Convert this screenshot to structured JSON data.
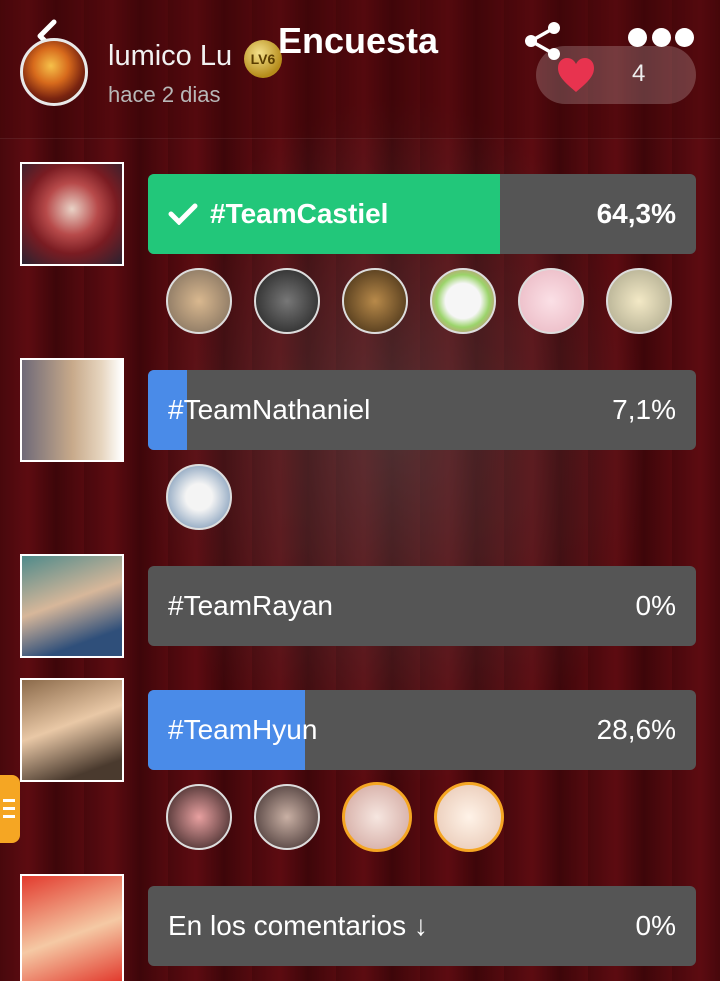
{
  "header": {
    "title": "Encuesta",
    "username": "lumico Lu",
    "level": "LV6",
    "time": "hace 2 dias",
    "likes": "4"
  },
  "options": [
    {
      "label": "#TeamCastiel",
      "percent": "64,3%",
      "value": 64.3,
      "selected": true,
      "color": "#22c77a",
      "voter_count": 6
    },
    {
      "label": "#TeamNathaniel",
      "percent": "7,1%",
      "value": 7.1,
      "selected": false,
      "color": "#4a8be8",
      "voter_count": 1
    },
    {
      "label": "#TeamRayan",
      "percent": "0%",
      "value": 0,
      "selected": false,
      "color": "#4a8be8",
      "voter_count": 0
    },
    {
      "label": "#TeamHyun",
      "percent": "28,6%",
      "value": 28.6,
      "selected": false,
      "color": "#4a8be8",
      "voter_count": 4
    },
    {
      "label": "En los comentarios ↓",
      "percent": "0%",
      "value": 0,
      "selected": false,
      "color": "#4a8be8",
      "voter_count": 0
    }
  ],
  "icons": [
    "back-arrow-icon",
    "share-icon",
    "more-icon",
    "heart-icon",
    "check-icon",
    "side-menu-icon"
  ]
}
